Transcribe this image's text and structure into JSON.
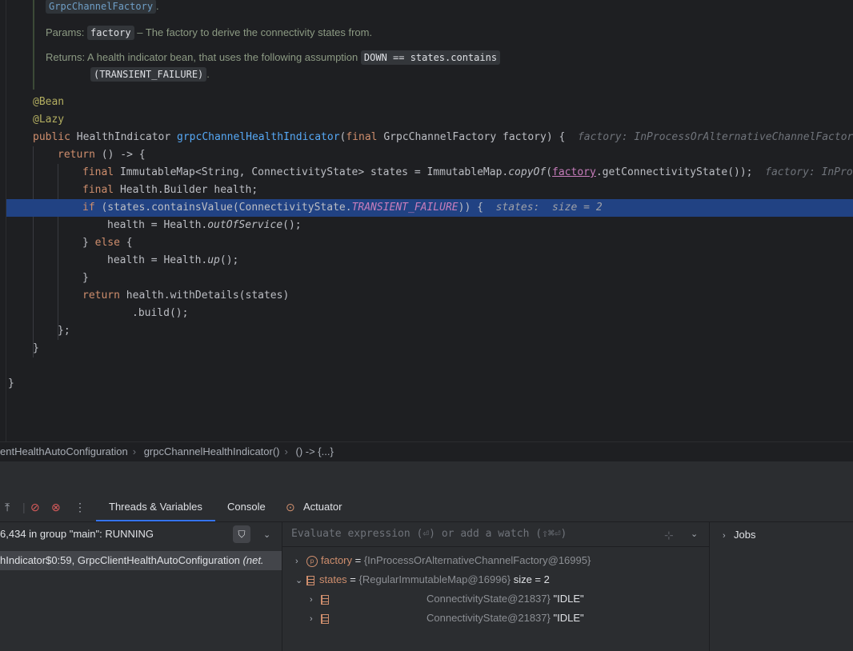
{
  "doc": {
    "link_chip": "GrpcChannelFactory",
    "link_period": ".",
    "params_label": "Params:",
    "param_name": "factory",
    "param_desc": "– The factory to derive the connectivity states from.",
    "returns_label": "Returns:",
    "returns_desc": "A health indicator bean, that uses the following assumption",
    "returns_code_1": "DOWN == states.contains",
    "returns_code_2": "(TRANSIENT_FAILURE)",
    "returns_period": "."
  },
  "code": {
    "ann_bean": "@Bean",
    "ann_lazy": "@Lazy",
    "l3_public": "public",
    "l3_type": " HealthIndicator ",
    "l3_method": "grpcChannelHealthIndicator",
    "l3_open": "(",
    "l3_final": "final",
    "l3_params": " GrpcChannelFactory factory) {",
    "l3_hint": "factory: InProcessOrAlternativeChannelFactory",
    "l4_return": "return",
    "l4_rest": " () -> {",
    "l5_final": "final",
    "l5_a": " ImmutableMap<String, ConnectivityState> states = ImmutableMap.",
    "l5_copy": "copyOf",
    "l5_open": "(",
    "l5_factory": "factory",
    "l5_b": ".getConnectivityState());",
    "l5_hint": "factory: InProcessOrAlternativeChannelFactory",
    "l6_final": "final",
    "l6_rest": " Health.Builder health;",
    "l7_if": "if",
    "l7_a": " (states.containsValue(ConnectivityState.",
    "l7_const": "TRANSIENT_FAILURE",
    "l7_b": ")) {",
    "l7_hint": "states:  size = 2",
    "l8_a": "health = Health.",
    "l8_fn": "outOfService",
    "l8_b": "();",
    "l9_a": "} ",
    "l9_else": "else",
    "l9_b": " {",
    "l10_a": "health = Health.",
    "l10_fn": "up",
    "l10_b": "();",
    "l11": "}",
    "l12_return": "return",
    "l12_rest": " health.withDetails(states)",
    "l13": ".build();",
    "l14": "};",
    "l15": "}",
    "l17": "}"
  },
  "breadcrumbs": {
    "class": "entHealthAutoConfiguration",
    "method": "grpcChannelHealthIndicator()",
    "lambda": "() -> {...}",
    "sep": "›"
  },
  "debug": {
    "tabs": [
      "Threads & Variables",
      "Console",
      "Actuator"
    ],
    "thread_text": "6,434 in group \"main\": RUNNING",
    "frame_text": "hIndicator$0:59, GrpcClientHealthAutoConfiguration",
    "frame_pkg": "(net.",
    "eval_placeholder": "Evaluate expression (⏎) or add a watch (⇧⌘⏎)",
    "vars": [
      {
        "name": "factory",
        "eq": " = ",
        "value": "{InProcessOrAlternativeChannelFactory@16995}",
        "extra": ""
      },
      {
        "name": "states",
        "eq": " = ",
        "value": "{RegularImmutableMap@16996}",
        "extra": "size = 2"
      },
      {
        "name": "",
        "eq": "",
        "value": "ConnectivityState@21837}",
        "extra": "\"IDLE\""
      },
      {
        "name": "",
        "eq": "",
        "value": "ConnectivityState@21837}",
        "extra": "\"IDLE\""
      }
    ],
    "jobs_label": "Jobs"
  }
}
